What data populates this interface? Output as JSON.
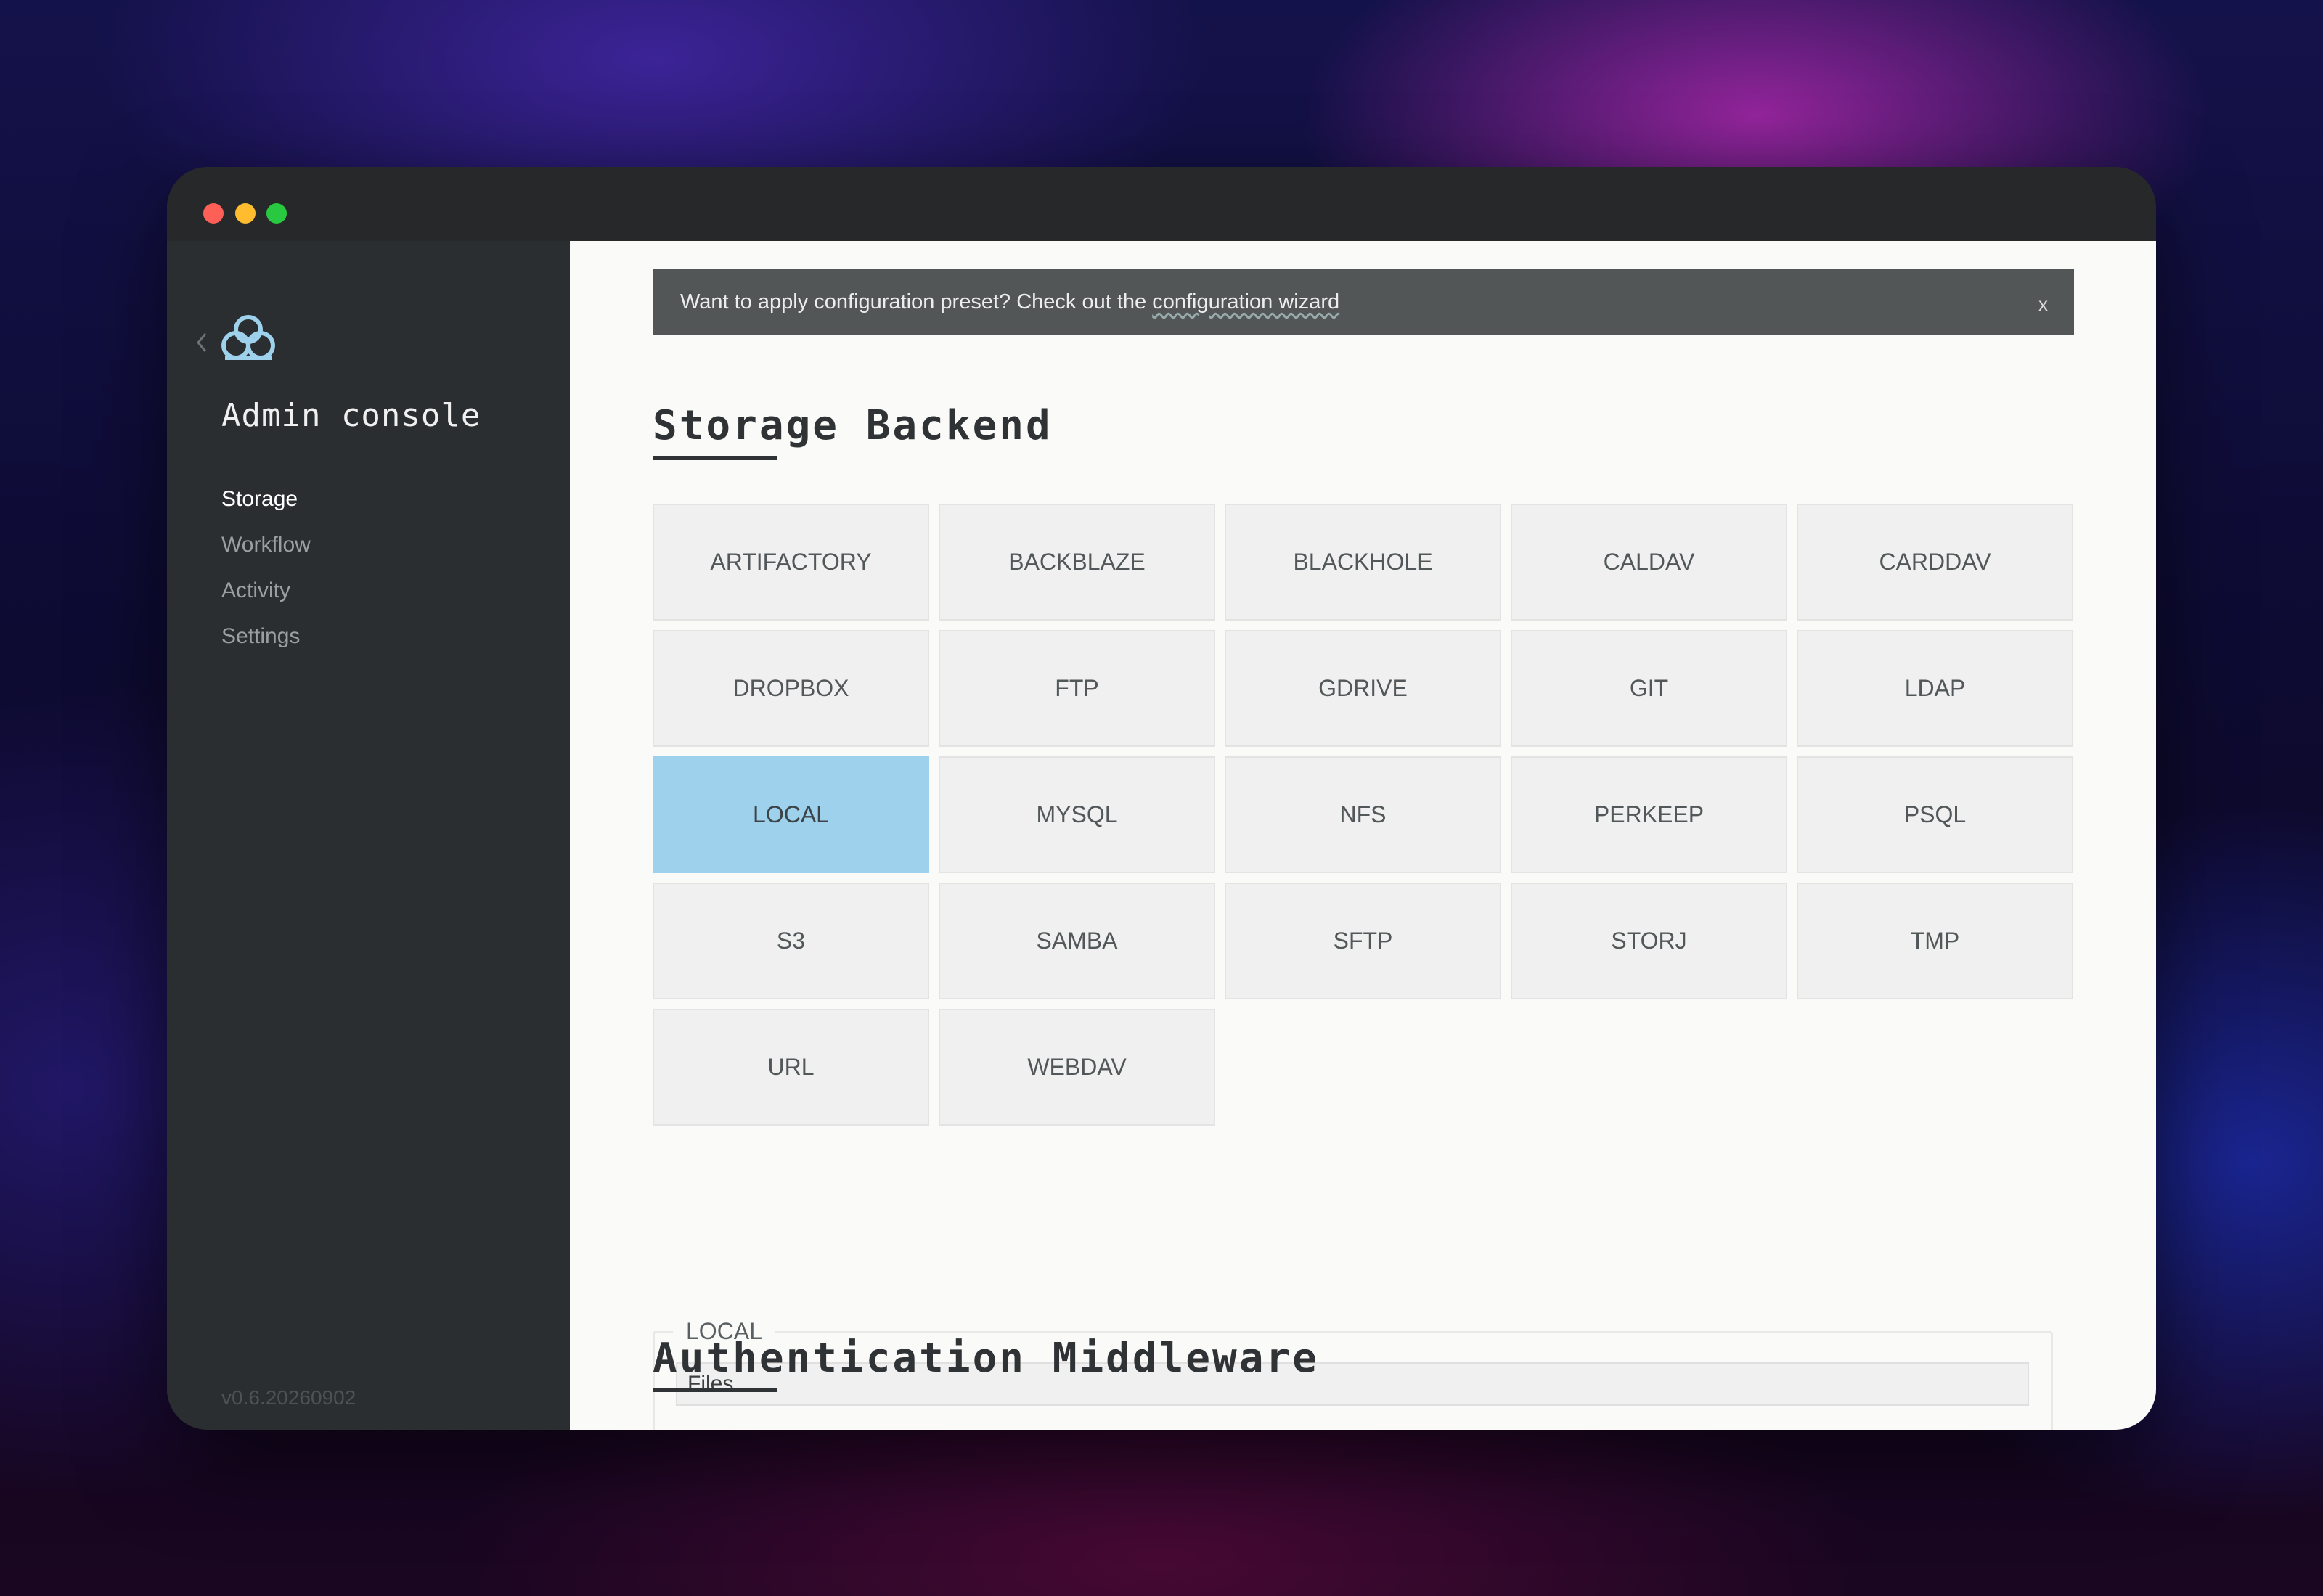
{
  "window": {
    "controls": [
      "close",
      "minimize",
      "maximize"
    ]
  },
  "sidebar": {
    "back_icon": "chevron-left-icon",
    "logo_icon": "cloud-icon",
    "title": "Admin console",
    "items": [
      {
        "label": "Storage",
        "active": true
      },
      {
        "label": "Workflow",
        "active": false
      },
      {
        "label": "Activity",
        "active": false
      },
      {
        "label": "Settings",
        "active": false
      }
    ],
    "version": "v0.6.20260902"
  },
  "banner": {
    "text": "Want to apply configuration preset? Check out the ",
    "link": "configuration wizard",
    "close_label": "x"
  },
  "storage": {
    "title": "Storage Backend",
    "backends": [
      "ARTIFACTORY",
      "BACKBLAZE",
      "BLACKHOLE",
      "CALDAV",
      "CARDDAV",
      "DROPBOX",
      "FTP",
      "GDRIVE",
      "GIT",
      "LDAP",
      "LOCAL",
      "MYSQL",
      "NFS",
      "PERKEEP",
      "PSQL",
      "S3",
      "SAMBA",
      "SFTP",
      "STORJ",
      "TMP",
      "URL",
      "WEBDAV"
    ],
    "selected": "LOCAL",
    "config": {
      "legend": "LOCAL",
      "path_value": "Files"
    }
  },
  "auth": {
    "title": "Authentication Middleware"
  },
  "colors": {
    "accent": "#9dd1ec",
    "sidebar_bg": "#2b2e30",
    "content_bg": "#fafaf8",
    "banner_bg": "#535657"
  }
}
